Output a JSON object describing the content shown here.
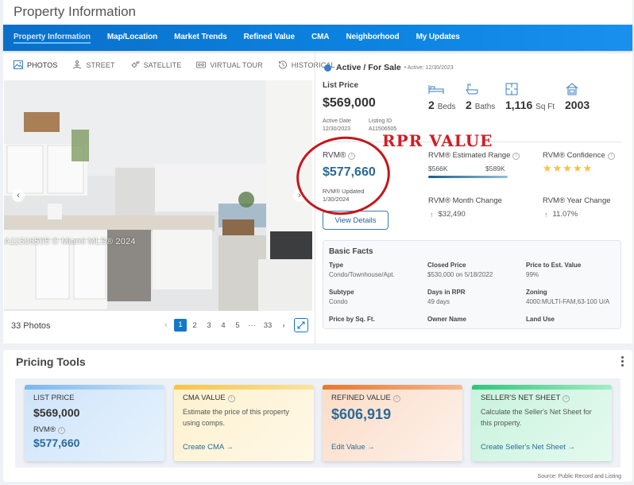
{
  "header": {
    "title": "Property Information"
  },
  "nav": {
    "items": [
      {
        "label": "Property Information",
        "active": true
      },
      {
        "label": "Map/Location"
      },
      {
        "label": "Market Trends"
      },
      {
        "label": "Refined Value"
      },
      {
        "label": "CMA"
      },
      {
        "label": "Neighborhood"
      },
      {
        "label": "My Updates"
      }
    ]
  },
  "media_tabs": [
    {
      "label": "PHOTOS",
      "icon": "image-icon",
      "active": true
    },
    {
      "label": "STREET",
      "icon": "street-view-icon"
    },
    {
      "label": "SATELLITE",
      "icon": "satellite-icon"
    },
    {
      "label": "VIRTUAL TOUR",
      "icon": "virtual-tour-icon"
    },
    {
      "label": "HISTORICAL",
      "icon": "history-icon"
    }
  ],
  "photo": {
    "watermark": "A11506505 © Miami MLS® 2024",
    "count_label": "33 Photos",
    "pager": {
      "prev": "‹",
      "pages": [
        "1",
        "2",
        "3",
        "4",
        "5",
        "···",
        "33"
      ],
      "current": "1",
      "next": "›"
    }
  },
  "status": {
    "label": "Active / For Sale",
    "sub": "• Active: 12/30/2023",
    "color": "#3a7cc5"
  },
  "listing": {
    "price_label": "List Price",
    "price": "$569,000",
    "active_date_label": "Active Date",
    "active_date": "12/30/2023",
    "listing_id_label": "Listing ID",
    "listing_id": "A11506505"
  },
  "features": {
    "beds": {
      "value": "2",
      "unit": "Beds"
    },
    "baths": {
      "value": "2",
      "unit": "Baths"
    },
    "sqft": {
      "value": "1,116",
      "unit": "Sq Ft"
    },
    "year_built": {
      "value": "2003"
    }
  },
  "annotation": {
    "text": "RPR VALUE",
    "color": "#d01d24"
  },
  "rvm": {
    "label": "RVM®",
    "value": "$577,660",
    "updated_label": "RVM® Updated",
    "updated_date": "1/30/2024",
    "view_details": "View Details",
    "range_label": "RVM® Estimated Range",
    "range_low": "$566K",
    "range_high": "$589K",
    "confidence_label": "RVM® Confidence",
    "confidence_stars": 5,
    "confidence_max": 5,
    "stars_text": "★★★★★",
    "month_change_label": "RVM® Month Change",
    "month_change": "$32,490",
    "year_change_label": "RVM® Year Change",
    "year_change": "11.07%",
    "change_direction": "up"
  },
  "basic_facts": {
    "title": "Basic Facts",
    "items": [
      {
        "key": "Type",
        "value": "Condo/Townhouse/Apt."
      },
      {
        "key": "Closed Price",
        "value": "$530,000 on 5/18/2022"
      },
      {
        "key": "Price to Est. Value",
        "value": "99%"
      },
      {
        "key": "Subtype",
        "value": "Condo"
      },
      {
        "key": "Days in RPR",
        "value": "49 days"
      },
      {
        "key": "Zoning",
        "value": "4000:MULTI-FAM,63-100 U/A"
      },
      {
        "key": "Price by Sq. Ft.",
        "value": ""
      },
      {
        "key": "Owner Name",
        "value": ""
      },
      {
        "key": "Land Use",
        "value": ""
      }
    ]
  },
  "pricing_tools": {
    "title": "Pricing Tools",
    "cards": {
      "list": {
        "title": "LIST PRICE",
        "value": "$569,000",
        "rvm_label": "RVM®",
        "rvm_value": "$577,660"
      },
      "cma": {
        "title": "CMA VALUE",
        "desc": "Estimate the price of this property using comps.",
        "link": "Create CMA →"
      },
      "refined": {
        "title": "REFINED VALUE",
        "value": "$606,919",
        "link": "Edit Value →"
      },
      "seller": {
        "title": "SELLER'S NET SHEET",
        "desc": "Calculate the Seller's Net Sheet for this property.",
        "link": "Create Seller's Net Sheet →"
      }
    },
    "source": "Source: Public Record and Listing"
  }
}
